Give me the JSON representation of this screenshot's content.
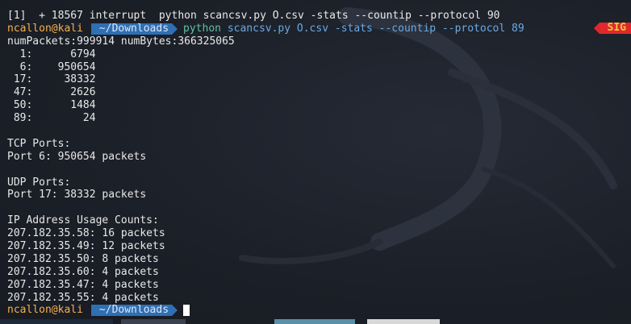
{
  "terminal": {
    "job_line": "[1]  + 18567 interrupt  python scancsv.py O.csv -stats --countip --protocol 90",
    "prompt1": {
      "user": "ncallon@kali",
      "dir": "~/Downloads",
      "cmd_python": "python",
      "cmd_args": "scancsv.py O.csv -stats --countip --protocol 89"
    },
    "sig_badge": "SIG",
    "output": [
      "numPackets:999914 numBytes:366325065",
      "  1:      6794",
      "  6:    950654",
      " 17:     38332",
      " 47:      2626",
      " 50:      1484",
      " 89:        24",
      "",
      "TCP Ports:",
      "Port 6: 950654 packets",
      "",
      "UDP Ports:",
      "Port 17: 38332 packets",
      "",
      "IP Address Usage Counts:",
      "207.182.35.58: 16 packets",
      "207.182.35.49: 12 packets",
      "207.182.35.50: 8 packets",
      "207.182.35.60: 4 packets",
      "207.182.35.47: 4 packets",
      "207.182.35.55: 4 packets"
    ],
    "prompt2": {
      "user": "ncallon@kali",
      "dir": "~/Downloads"
    }
  },
  "colors": {
    "background": "#1d212a",
    "user": "#f5b14d",
    "dir_bg": "#2f6fb4",
    "python_cmd": "#5fc0a8",
    "args": "#6ba9e4",
    "sig_bg": "#e0282c",
    "sig_fg": "#f5c541"
  }
}
